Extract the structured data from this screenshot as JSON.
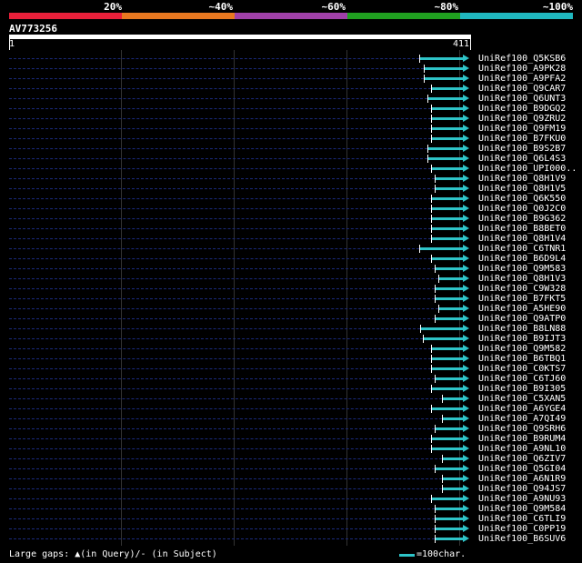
{
  "percent_scale": {
    "labels": [
      "20%",
      "~40%",
      "~60%",
      "~80%",
      "~100%"
    ],
    "colors": [
      "#e8203a",
      "#e87820",
      "#a040a8",
      "#20a020",
      "#20b8c0"
    ]
  },
  "query": {
    "name": "AV773256",
    "start": "1",
    "end": "411"
  },
  "hit_color": "#2ec4c8",
  "hits": [
    {
      "label": "UniRef100_Q5KSB6",
      "start_pct": 0.903
    },
    {
      "label": "UniRef100_A9PK28",
      "start_pct": 0.913
    },
    {
      "label": "UniRef100_A9PFA2",
      "start_pct": 0.913
    },
    {
      "label": "UniRef100_Q9CAR7",
      "start_pct": 0.929
    },
    {
      "label": "UniRef100_Q6UNT3",
      "start_pct": 0.921
    },
    {
      "label": "UniRef100_B9DGQ2",
      "start_pct": 0.929
    },
    {
      "label": "UniRef100_Q9ZRU2",
      "start_pct": 0.929
    },
    {
      "label": "UniRef100_Q9FM19",
      "start_pct": 0.929
    },
    {
      "label": "UniRef100_B7FKU0",
      "start_pct": 0.929
    },
    {
      "label": "UniRef100_B9S2B7",
      "start_pct": 0.921
    },
    {
      "label": "UniRef100_Q6L4S3",
      "start_pct": 0.921
    },
    {
      "label": "UniRef100_UPI000..",
      "start_pct": 0.929
    },
    {
      "label": "UniRef100_Q8H1V9",
      "start_pct": 0.937
    },
    {
      "label": "UniRef100_Q8H1V5",
      "start_pct": 0.937
    },
    {
      "label": "UniRef100_Q6K550",
      "start_pct": 0.929
    },
    {
      "label": "UniRef100_Q0J2C0",
      "start_pct": 0.929
    },
    {
      "label": "UniRef100_B9G362",
      "start_pct": 0.929
    },
    {
      "label": "UniRef100_B8BET0",
      "start_pct": 0.929
    },
    {
      "label": "UniRef100_Q8H1V4",
      "start_pct": 0.929
    },
    {
      "label": "UniRef100_C6TNR1",
      "start_pct": 0.903
    },
    {
      "label": "UniRef100_B6D9L4",
      "start_pct": 0.929
    },
    {
      "label": "UniRef100_Q9M583",
      "start_pct": 0.937
    },
    {
      "label": "UniRef100_Q8H1V3",
      "start_pct": 0.945
    },
    {
      "label": "UniRef100_C9W328",
      "start_pct": 0.937
    },
    {
      "label": "UniRef100_B7FKT5",
      "start_pct": 0.937
    },
    {
      "label": "UniRef100_A5HE90",
      "start_pct": 0.945
    },
    {
      "label": "UniRef100_Q9ATP0",
      "start_pct": 0.937
    },
    {
      "label": "UniRef100_B8LN88",
      "start_pct": 0.905
    },
    {
      "label": "UniRef100_B9IJT3",
      "start_pct": 0.911
    },
    {
      "label": "UniRef100_Q9M582",
      "start_pct": 0.929
    },
    {
      "label": "UniRef100_B6TBQ1",
      "start_pct": 0.929
    },
    {
      "label": "UniRef100_C0KTS7",
      "start_pct": 0.929
    },
    {
      "label": "UniRef100_C6TJ60",
      "start_pct": 0.937
    },
    {
      "label": "UniRef100_B9I305",
      "start_pct": 0.929
    },
    {
      "label": "UniRef100_C5XAN5",
      "start_pct": 0.953
    },
    {
      "label": "UniRef100_A6YGE4",
      "start_pct": 0.929
    },
    {
      "label": "UniRef100_A7QI49",
      "start_pct": 0.953
    },
    {
      "label": "UniRef100_Q9SRH6",
      "start_pct": 0.937
    },
    {
      "label": "UniRef100_B9RUM4",
      "start_pct": 0.929
    },
    {
      "label": "UniRef100_A9NL10",
      "start_pct": 0.929
    },
    {
      "label": "UniRef100_Q6ZIV7",
      "start_pct": 0.953
    },
    {
      "label": "UniRef100_Q5GI04",
      "start_pct": 0.937
    },
    {
      "label": "UniRef100_A6N1R9",
      "start_pct": 0.953
    },
    {
      "label": "UniRef100_Q94JS7",
      "start_pct": 0.953
    },
    {
      "label": "UniRef100_A9NU93",
      "start_pct": 0.929
    },
    {
      "label": "UniRef100_Q9M584",
      "start_pct": 0.937
    },
    {
      "label": "UniRef100_C6TLI9",
      "start_pct": 0.937
    },
    {
      "label": "UniRef100_C0PP19",
      "start_pct": 0.937
    },
    {
      "label": "UniRef100_B6SUV6",
      "start_pct": 0.937
    }
  ],
  "footer": {
    "gaps_legend": "Large gaps: ▲(in Query)/- (in Subject)",
    "scale_legend": "=100char."
  }
}
